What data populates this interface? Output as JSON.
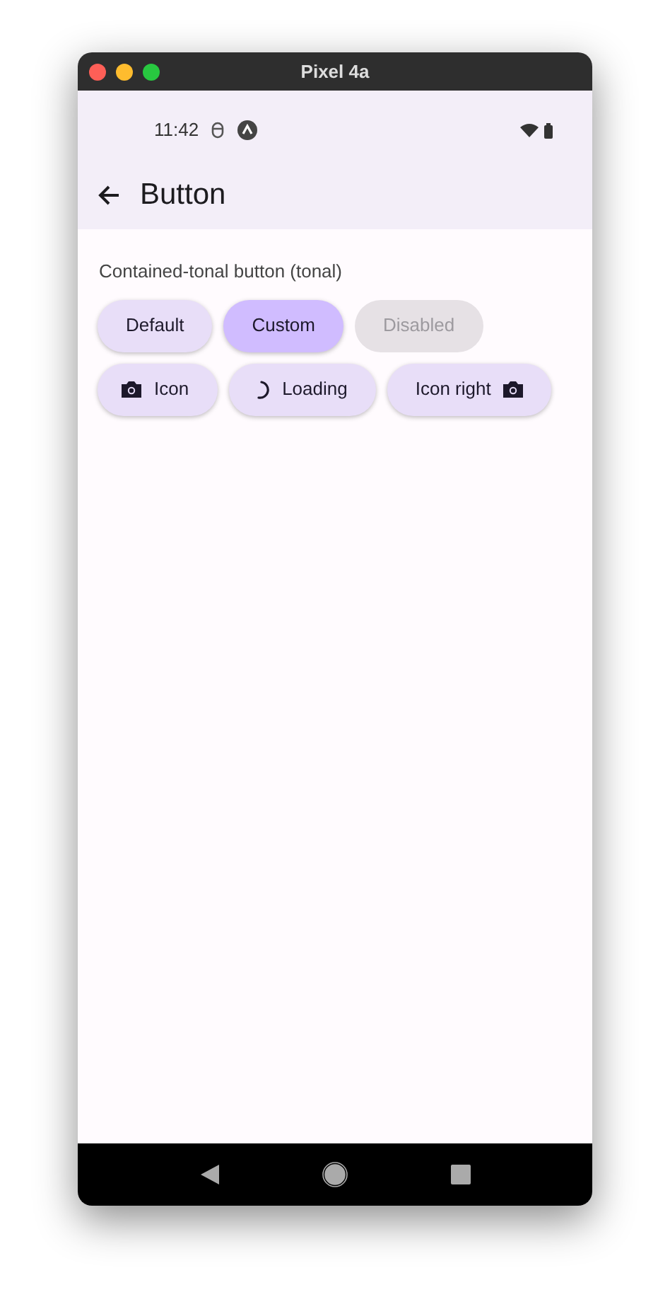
{
  "window": {
    "title": "Pixel 4a"
  },
  "status_bar": {
    "time": "11:42"
  },
  "app_bar": {
    "title": "Button"
  },
  "section": {
    "title": "Contained-tonal button (tonal)"
  },
  "button_rows": [
    [
      {
        "label": "Default",
        "kind": "text",
        "disabled": false
      },
      {
        "label": "Custom",
        "kind": "accent",
        "disabled": false
      },
      {
        "label": "Disabled",
        "kind": "text",
        "disabled": true
      }
    ],
    [
      {
        "label": "Icon",
        "kind": "icon-left",
        "disabled": false
      },
      {
        "label": "Loading",
        "kind": "loading",
        "disabled": false
      },
      {
        "label": "Icon right",
        "kind": "icon-right",
        "disabled": false
      }
    ]
  ]
}
